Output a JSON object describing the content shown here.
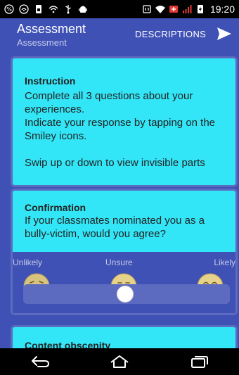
{
  "status_bar": {
    "time": "19:20",
    "icons_left": [
      "percent-icon",
      "wifi-hotspot-icon",
      "sim-icon",
      "wifi-direct-icon",
      "usb-icon",
      "android-icon"
    ],
    "icons_right": [
      "nfc-icon",
      "wifi-icon",
      "battery-saver-icon",
      "signal-icon",
      "battery-icon"
    ]
  },
  "app_bar": {
    "title": "Assessment",
    "subtitle": "Assessment",
    "descriptions_label": "DESCRIPTIONS",
    "send_icon": "send-icon",
    "background": "#3f51b5"
  },
  "cards": {
    "instruction": {
      "heading": "Instruction",
      "line1": "Complete all 3 questions about your experiences.",
      "line2": "Indicate your response by tapping on the Smiley icons.",
      "line3": "Swip up or down to view invisible parts"
    },
    "confirmation": {
      "heading": "Confirmation",
      "question": "If your classmates nominated you as a bully-victim, would you agree?",
      "options": {
        "unlikely": "Unlikely",
        "unsure": "Unsure",
        "likely": "Likely"
      },
      "selected_option": "Unsure"
    },
    "next": {
      "heading": "Content obscenity"
    }
  },
  "colors": {
    "card_bg": "#33e6f7",
    "card_border": "#5c6bc0",
    "primary": "#3f51b5"
  },
  "nav_bar": {
    "icons": [
      "back-icon",
      "home-icon",
      "recents-icon"
    ]
  }
}
